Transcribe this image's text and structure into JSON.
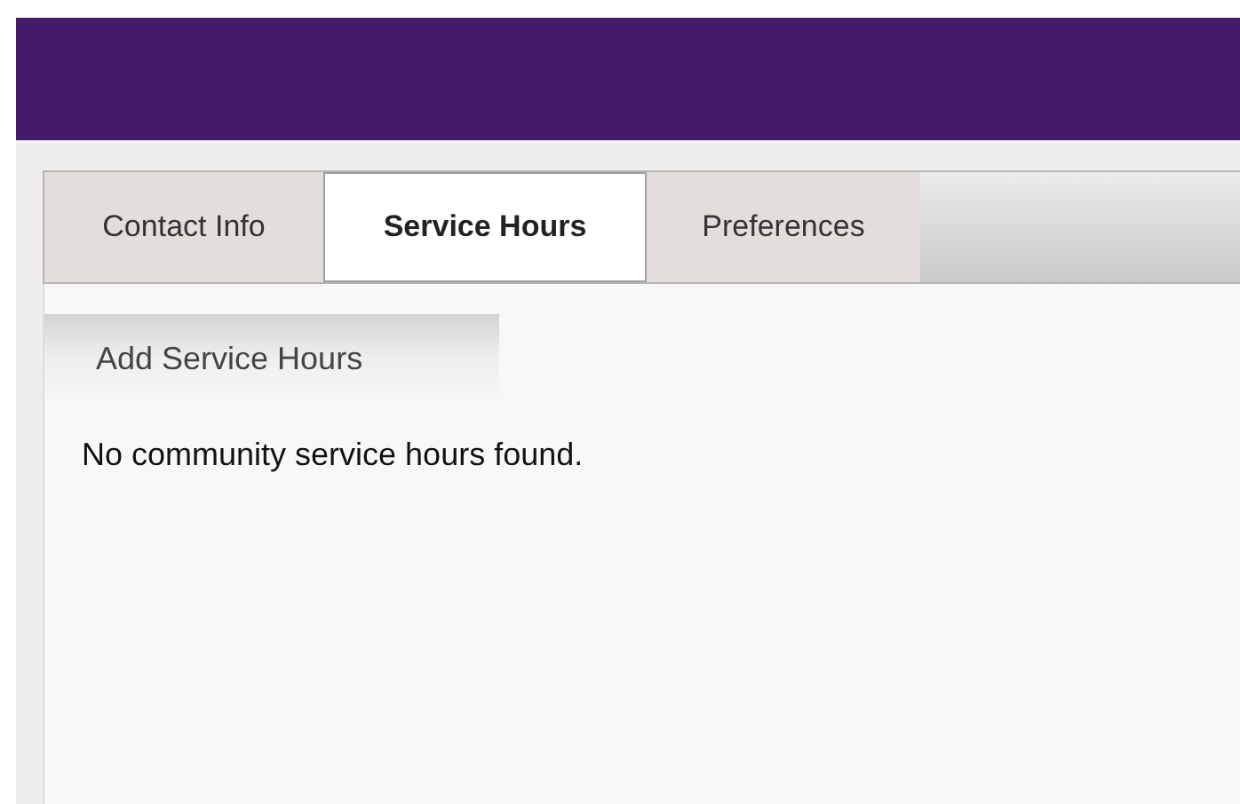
{
  "tabs": [
    {
      "label": "Contact Info",
      "selected": false
    },
    {
      "label": "Service Hours",
      "selected": true
    },
    {
      "label": "Preferences",
      "selected": false
    }
  ],
  "add_button": "Add Service Hours",
  "message": "No community service hours found."
}
